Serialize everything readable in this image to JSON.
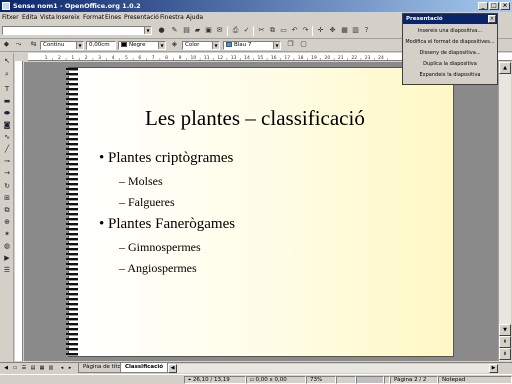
{
  "window": {
    "title": "Sense nom1 - OpenOffice.org 1.0.2"
  },
  "menubar": [
    "Fitxer",
    "Edita",
    "Vista",
    "Insereix",
    "Format",
    "Eines",
    "Presentació",
    "Finestra",
    "Ajuda"
  ],
  "toolbar": {
    "line_style": "Continu",
    "line_width": "0,00cm",
    "line_color": "Negre",
    "area_style": "Color",
    "area_color": "Blau 7",
    "colors": {
      "line": "#000000",
      "area": "#3399ff"
    }
  },
  "presentation_panel": {
    "title": "Presentació",
    "items": [
      "Insereix una diapositiva...",
      "Modifica el format de diapositives...",
      "Disseny de diapositiva...",
      "Duplica la diapositiva",
      "Expandeix la diapositiva"
    ]
  },
  "slide": {
    "title": "Les plantes – classificació",
    "bullets": [
      {
        "level": 1,
        "text": "Plantes criptògrames"
      },
      {
        "level": 2,
        "text": "Molses"
      },
      {
        "level": 2,
        "text": "Falgueres"
      },
      {
        "level": 1,
        "text": "Plantes Fanerògames"
      },
      {
        "level": 2,
        "text": "Gimnospermes"
      },
      {
        "level": 2,
        "text": "Angiospermes"
      }
    ]
  },
  "ruler": {
    "marks": [
      "1",
      "2",
      "1",
      "2",
      "3",
      "4",
      "5",
      "6",
      "7",
      "8",
      "9",
      "10",
      "11",
      "12",
      "13",
      "14",
      "15",
      "16",
      "17",
      "18",
      "19",
      "20",
      "21",
      "22",
      "23",
      "24"
    ]
  },
  "tabs": [
    "Pàgina de títol",
    "Classificació"
  ],
  "statusbar": {
    "position": "26,10 / 13,19",
    "size": "0,00 x 0,00",
    "zoom": "73%",
    "page": "Pàgina 2 / 2",
    "layout": "Notepad"
  }
}
